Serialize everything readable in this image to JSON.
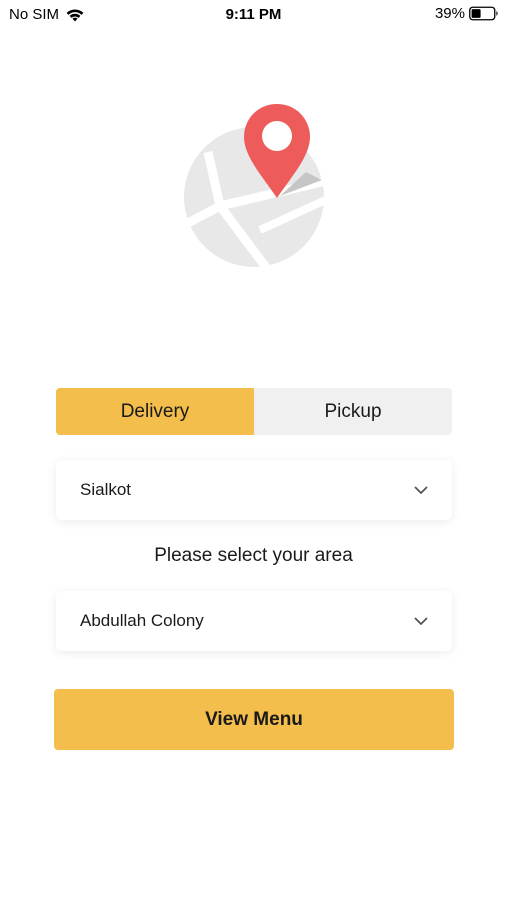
{
  "status_bar": {
    "carrier": "No SIM",
    "time": "9:11 PM",
    "battery": "39%"
  },
  "order_type": {
    "tabs": [
      {
        "label": "Delivery",
        "active": true
      },
      {
        "label": "Pickup",
        "active": false
      }
    ]
  },
  "city_select": {
    "value": "Sialkot"
  },
  "area_prompt": "Please select your area",
  "area_select": {
    "value": "Abdullah Colony"
  },
  "primary_button": {
    "label": "View Menu"
  },
  "colors": {
    "accent": "#f3be4b",
    "pin": "#ee5b5b",
    "map": "#e8e8e8"
  },
  "icons": {
    "hero": "map-pin-illustration",
    "wifi": "wifi-icon",
    "battery": "battery-icon",
    "chevron": "chevron-down-icon"
  }
}
